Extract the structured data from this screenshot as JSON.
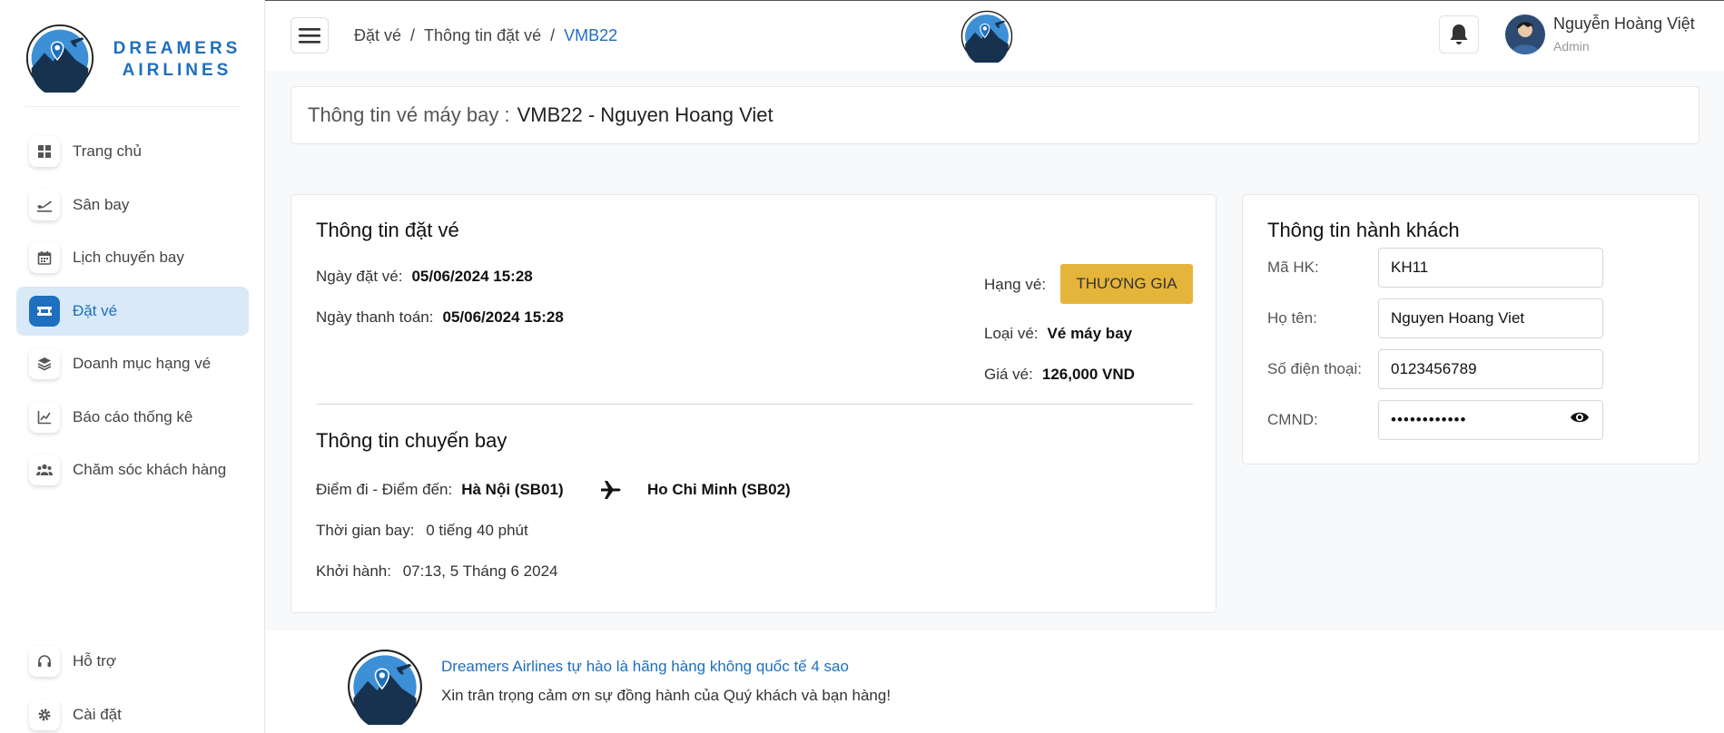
{
  "brand": {
    "line1": "DREAMERS",
    "line2": "AIRLINES",
    "logo_icon": "dreamers-logo"
  },
  "sidebar": {
    "items": [
      {
        "label": "Trang chủ",
        "icon": "windows-icon"
      },
      {
        "label": "Sân bay",
        "icon": "plane-departure-icon"
      },
      {
        "label": "Lịch chuyến bay",
        "icon": "calendar-icon"
      },
      {
        "label": "Đặt vé",
        "icon": "ticket-icon",
        "active": true
      },
      {
        "label": "Doanh mục hạng vé",
        "icon": "layers-icon"
      },
      {
        "label": "Báo cáo thống kê",
        "icon": "line-chart-icon"
      },
      {
        "label": "Chăm sóc khách hàng",
        "icon": "users-icon"
      }
    ],
    "bottom": [
      {
        "label": "Hỗ trợ",
        "icon": "headset-icon"
      },
      {
        "label": "Cài đặt",
        "icon": "gear-icon"
      }
    ]
  },
  "header": {
    "breadcrumb": [
      "Đặt vé",
      "Thông tin đặt vé",
      "VMB22"
    ],
    "user_name": "Nguyễn Hoàng Việt",
    "user_role": "Admin"
  },
  "title": {
    "label": "Thông tin vé máy bay :",
    "value": "VMB22 - Nguyen Hoang Viet"
  },
  "booking": {
    "heading": "Thông tin đặt vé",
    "booking_date_label": "Ngày đặt vé:",
    "booking_date": "05/06/2024 15:28",
    "payment_date_label": "Ngày thanh toán:",
    "payment_date": "05/06/2024 15:28",
    "class_label": "Hạng vé:",
    "class_value": "THƯƠNG GIA",
    "type_label": "Loại vé:",
    "type_value": "Vé máy bay",
    "price_label": "Giá vé:",
    "price_value": "126,000 VND"
  },
  "flight": {
    "heading": "Thông tin chuyến bay",
    "route_label": "Điểm đi - Điểm đến:",
    "from": "Hà Nội (SB01)",
    "to": "Ho Chi Minh (SB02)",
    "duration_label": "Thời gian bay:",
    "duration": "0 tiếng 40 phút",
    "departure_label": "Khởi hành:",
    "departure": "07:13, 5 Tháng 6 2024"
  },
  "passenger": {
    "heading": "Thông tin hành khách",
    "id_label": "Mã HK:",
    "id_value": "KH11",
    "name_label": "Họ tên:",
    "name_value": "Nguyen Hoang Viet",
    "phone_label": "Số điện thoại:",
    "phone_value": "0123456789",
    "cmnd_label": "CMND:",
    "cmnd_value": "••••••••••••"
  },
  "footer": {
    "line1": "Dreamers Airlines tự hào là hãng hàng không quốc tế 4 sao",
    "line2": "Xin trân trọng cảm ơn sự đồng hành của Quý khách và bạn hàng!"
  },
  "colors": {
    "accent": "#1e6fbf",
    "badge": "#e5b43a",
    "active_bg": "#d9e9f7"
  }
}
